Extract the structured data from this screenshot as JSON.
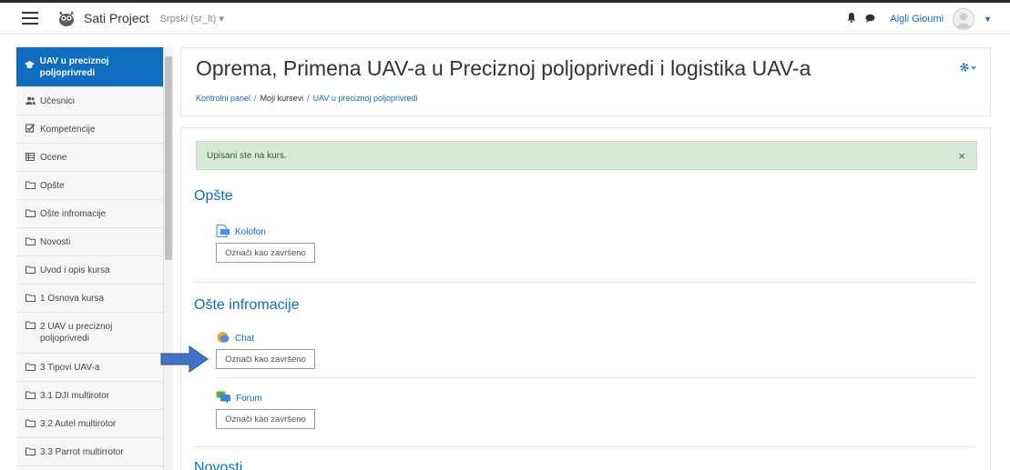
{
  "topbar": {
    "site_name": "Sati Project",
    "language": "Srpski (sr_lt) ▾",
    "username": "Aigli Gioumi",
    "icons": [
      "bell-icon",
      "chat-bubble-icon"
    ]
  },
  "sidebar": {
    "items": [
      {
        "icon": "graduation-cap-icon",
        "label": "UAV u preciznoj poljoprivredi",
        "active": true
      },
      {
        "icon": "users-icon",
        "label": "Učesnici"
      },
      {
        "icon": "checkbox-icon",
        "label": "Kompetencije"
      },
      {
        "icon": "table-icon",
        "label": "Ocene"
      },
      {
        "icon": "folder-icon",
        "label": "Opšte"
      },
      {
        "icon": "folder-icon",
        "label": "Ošte infromacije"
      },
      {
        "icon": "folder-icon",
        "label": "Novosti"
      },
      {
        "icon": "folder-icon",
        "label": "Uvod i opis kursa"
      },
      {
        "icon": "folder-icon",
        "label": "1 Osnova kursa"
      },
      {
        "icon": "folder-icon",
        "label": "2 UAV u preciznoj poljoprivredi"
      },
      {
        "icon": "folder-icon",
        "label": "3 Tipovi UAV-a"
      },
      {
        "icon": "folder-icon",
        "label": "3.1 DJI multirotor"
      },
      {
        "icon": "folder-icon",
        "label": "3.2 Autel multirotor"
      },
      {
        "icon": "folder-icon",
        "label": "3.3 Parrot multirrotor"
      }
    ]
  },
  "header": {
    "title": "Oprema, Primena UAV-a u Preciznoj poljoprivredi i logistika UAV-a",
    "breadcrumb": [
      "Kontrolni panel",
      "Moji kursevi",
      "UAV u preciznoj poljoprivredi"
    ]
  },
  "alert": {
    "text": "Upisani ste na kurs.",
    "close": "×"
  },
  "sections": [
    {
      "title": "Opšte",
      "activities": [
        {
          "icon": "page-icon",
          "name": "Kolofon",
          "button": "Označi kao završeno"
        }
      ]
    },
    {
      "title": "Ošte infromacije",
      "activities": [
        {
          "icon": "chat-icon",
          "name": "Chat",
          "button": "Označi kao završeno"
        },
        {
          "icon": "forum-icon",
          "name": "Forum",
          "button": "Označi kao završeno"
        }
      ]
    },
    {
      "title": "Novosti",
      "activities": []
    }
  ],
  "colors": {
    "accent": "#0f6cbf",
    "alert_bg": "#d7e9d9",
    "arrow": "#4472c4"
  }
}
